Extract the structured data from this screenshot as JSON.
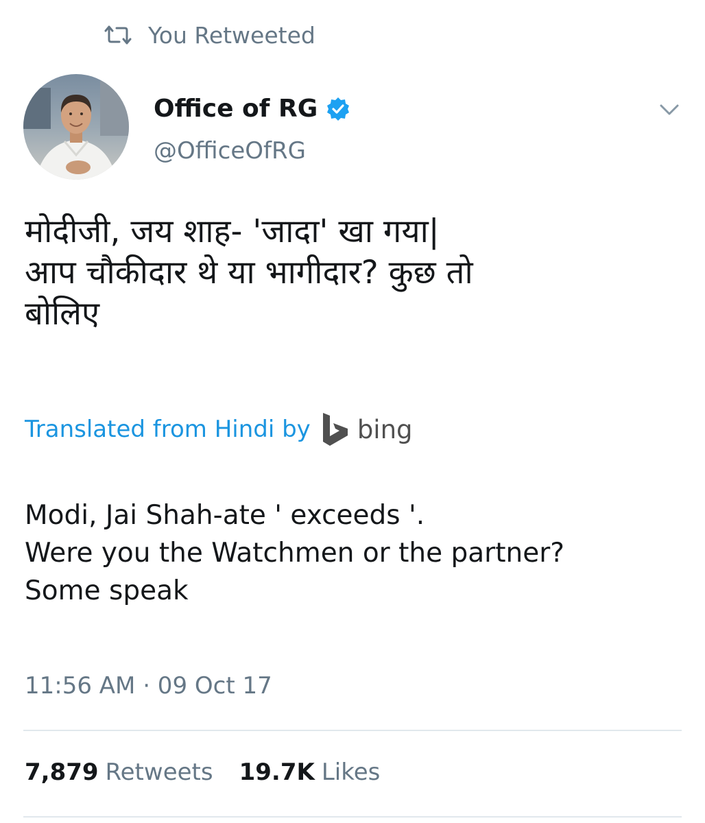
{
  "retweet_banner": {
    "text": "You Retweeted",
    "icon": "retweet-icon"
  },
  "tweet": {
    "display_name": "Office of RG",
    "handle": "@OfficeOfRG",
    "verified_icon": "verified-badge-icon",
    "more_icon": "chevron-down-icon",
    "avatar": "avatar-photo",
    "text_hindi": "मोदीजी, जय शाह- 'जादा'  खा गया|\nआप चौकीदार थे या भागीदार? कुछ तो\nबोलिए",
    "translation_label": "Translated from Hindi by",
    "translation_provider": "bing",
    "translation_logo_icon": "bing-logo-icon",
    "text_english": "Modi, Jai Shah-ate ' exceeds '.\nWere you the Watchmen or the partner?\nSome speak",
    "timestamp": "11:56 AM · 09 Oct 17",
    "stats": {
      "retweets_count": "7,879",
      "retweets_label": "Retweets",
      "likes_count": "19.7K",
      "likes_label": "Likes"
    }
  },
  "colors": {
    "link_blue": "#1b95e0",
    "verified_blue": "#1da1f2",
    "secondary_gray": "#657786",
    "text_black": "#14171a",
    "divider": "#e1e8ed"
  }
}
